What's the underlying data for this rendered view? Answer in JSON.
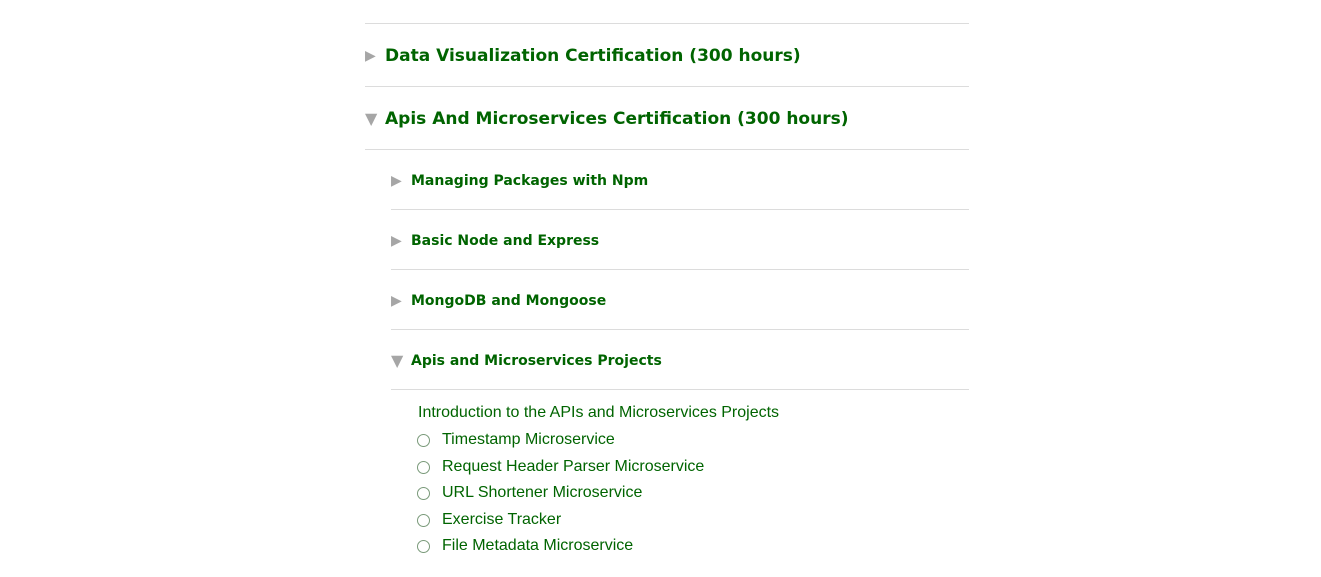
{
  "certifications": [
    {
      "title": "Data Visualization Certification (300 hours)",
      "expanded": false
    },
    {
      "title": "Apis And Microservices Certification (300 hours)",
      "expanded": true
    }
  ],
  "blocks": [
    {
      "title": "Managing Packages with Npm",
      "expanded": false
    },
    {
      "title": "Basic Node and Express",
      "expanded": false
    },
    {
      "title": "MongoDB and Mongoose",
      "expanded": false
    },
    {
      "title": "Apis and Microservices Projects",
      "expanded": true
    }
  ],
  "projects": {
    "intro": "Introduction to the APIs and Microservices Projects",
    "challenges": [
      {
        "label": "Timestamp Microservice",
        "completed": false
      },
      {
        "label": "Request Header Parser Microservice",
        "completed": false
      },
      {
        "label": "URL Shortener Microservice",
        "completed": false
      },
      {
        "label": "Exercise Tracker",
        "completed": false
      },
      {
        "label": "File Metadata Microservice",
        "completed": false
      }
    ]
  },
  "icons": {
    "collapsed": "▶",
    "expanded": "▼"
  },
  "colors": {
    "link_green": "#006400",
    "arrow_gray": "#a6a6a6",
    "divider": "#dcdcdc"
  }
}
